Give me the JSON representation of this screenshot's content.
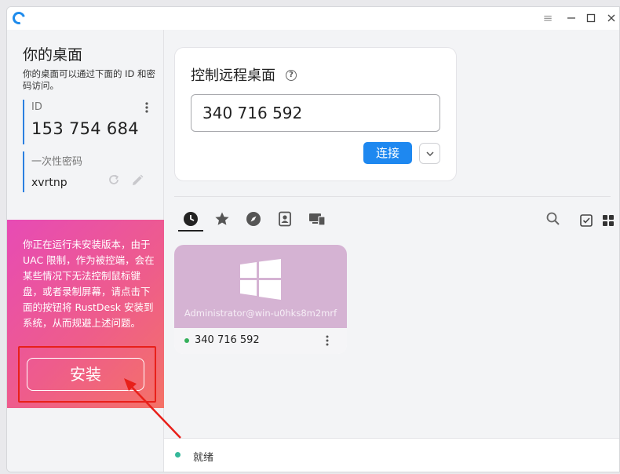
{
  "titlebar": {
    "menu_icon": "hamburger-icon",
    "minimize_icon": "minimize-icon",
    "maximize_icon": "maximize-icon",
    "close_icon": "close-icon"
  },
  "sidebar": {
    "title": "你的桌面",
    "description": "你的桌面可以通过下面的 ID 和密码访问。",
    "id_label": "ID",
    "id_value": "153 754 684",
    "password_label": "一次性密码",
    "password_value": "xvrtnp"
  },
  "promo": {
    "text": "你正在运行未安装版本，由于 UAC 限制，作为被控端，会在某些情况下无法控制鼠标键盘，或者录制屏幕，请点击下面的按钮将 RustDesk 安装到系统，从而规避上述问题。",
    "install_label": "安装",
    "accent": "#e74bb5"
  },
  "remote": {
    "title": "控制远程桌面",
    "input_value": "340 716 592",
    "connect_label": "连接",
    "accent": "#1e88f0"
  },
  "tabs": [
    {
      "icon": "clock-icon",
      "active": true
    },
    {
      "icon": "star-icon",
      "active": false
    },
    {
      "icon": "compass-icon",
      "active": false
    },
    {
      "icon": "address-book-icon",
      "active": false
    },
    {
      "icon": "lan-devices-icon",
      "active": false
    }
  ],
  "peers": [
    {
      "username": "Administrator@win-u0hks8m2mrf",
      "id": "340 716 592",
      "online": true
    }
  ],
  "status": {
    "text": "就绪"
  }
}
